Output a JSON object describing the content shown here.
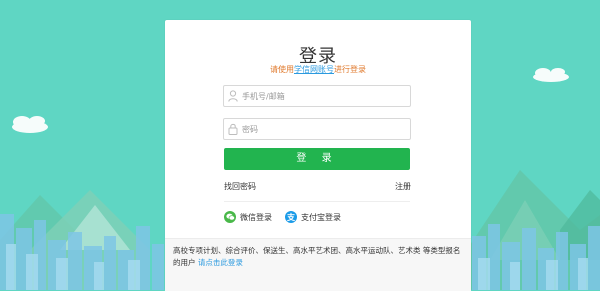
{
  "login": {
    "title": "登录",
    "subtitle_prefix": "请使用",
    "subtitle_link": "学信网账号",
    "subtitle_suffix": "进行登录",
    "username_placeholder": "手机号/邮箱",
    "password_placeholder": "密码",
    "submit_label": "登 录",
    "forgot_label": "找回密码",
    "register_label": "注册",
    "wechat_label": "微信登录",
    "alipay_label": "支付宝登录",
    "notice_text": "高校专项计划、综合评价、保送生、高水平艺术团、高水平运动队、艺术类 等类型报名的用户 ",
    "notice_link": "请点击此登录"
  },
  "colors": {
    "background": "#5fd6c3",
    "accent_green": "#22b44f",
    "link_blue": "#2b9adf",
    "subtitle_orange": "#e07a2d"
  },
  "icons": {
    "username": "user-icon",
    "password": "lock-icon",
    "wechat": "wechat-icon",
    "alipay": "alipay-icon"
  }
}
